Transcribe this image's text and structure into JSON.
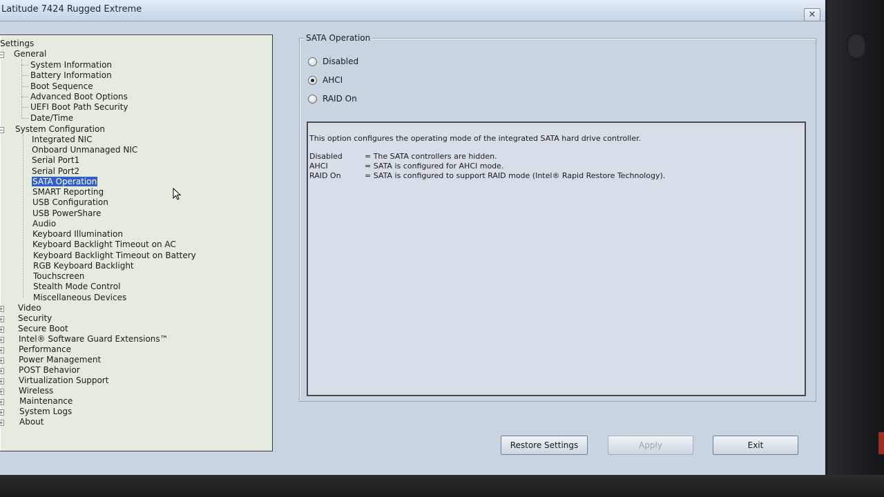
{
  "window": {
    "title": "Latitude 7424 Rugged Extreme"
  },
  "tree": {
    "root": "Settings",
    "general_label": "General",
    "general_items": [
      "System Information",
      "Battery Information",
      "Boot Sequence",
      "Advanced Boot Options",
      "UEFI Boot Path Security",
      "Date/Time"
    ],
    "sysconf_label": "System Configuration",
    "sysconf_items": [
      "Integrated NIC",
      "Onboard Unmanaged NIC",
      "Serial Port1",
      "Serial Port2",
      "SATA Operation",
      "SMART Reporting",
      "USB Configuration",
      "USB PowerShare",
      "Audio",
      "Keyboard Illumination",
      "Keyboard Backlight Timeout on AC",
      "Keyboard Backlight Timeout on Battery",
      "RGB Keyboard Backlight",
      "Touchscreen",
      "Stealth Mode Control",
      "Miscellaneous Devices"
    ],
    "collapsed": [
      "Video",
      "Security",
      "Secure Boot",
      "Intel® Software Guard Extensions™",
      "Performance",
      "Power Management",
      "POST Behavior",
      "Virtualization Support",
      "Wireless",
      "Maintenance",
      "System Logs",
      "About"
    ],
    "selected": "SATA Operation"
  },
  "panel": {
    "legend": "SATA Operation",
    "options": [
      {
        "label": "Disabled",
        "checked": false
      },
      {
        "label": "AHCI",
        "checked": true
      },
      {
        "label": "RAID On",
        "checked": false
      }
    ],
    "description": {
      "intro": "This option configures the operating mode of the integrated SATA hard drive controller.",
      "rows": [
        {
          "term": "Disabled",
          "def": "= The SATA controllers are hidden."
        },
        {
          "term": "AHCI",
          "def": "= SATA is configured for AHCI mode."
        },
        {
          "term": "RAID On",
          "def": "= SATA is configured to support RAID mode (Intel® Rapid Restore Technology)."
        }
      ]
    }
  },
  "buttons": {
    "restore": "Restore Settings",
    "apply": "Apply",
    "exit": "Exit"
  }
}
